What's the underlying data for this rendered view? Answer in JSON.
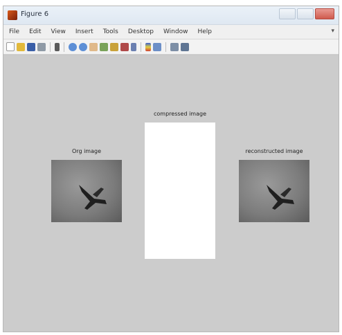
{
  "window": {
    "title": "Figure 6"
  },
  "menu": [
    "File",
    "Edit",
    "View",
    "Insert",
    "Tools",
    "Desktop",
    "Window",
    "Help"
  ],
  "toolbar_icons": [
    "new-figure-icon",
    "open-file-icon",
    "save-icon",
    "print-icon",
    "pointer-icon",
    "zoom-in-icon",
    "zoom-out-icon",
    "pan-icon",
    "rotate-icon",
    "data-cursor-icon",
    "brush-icon",
    "link-icon",
    "colorbar-icon",
    "legend-icon",
    "hide-plot-tools-icon",
    "show-plot-tools-icon"
  ],
  "axes": {
    "original_title": "Org image",
    "compressed_title": "compressed image",
    "reconstructed_title": "reconstructed image"
  },
  "colors": {
    "figure_bg": "#cccccc",
    "titlebar": "#dfe8f2",
    "image_bg": "#7a7a7a"
  }
}
